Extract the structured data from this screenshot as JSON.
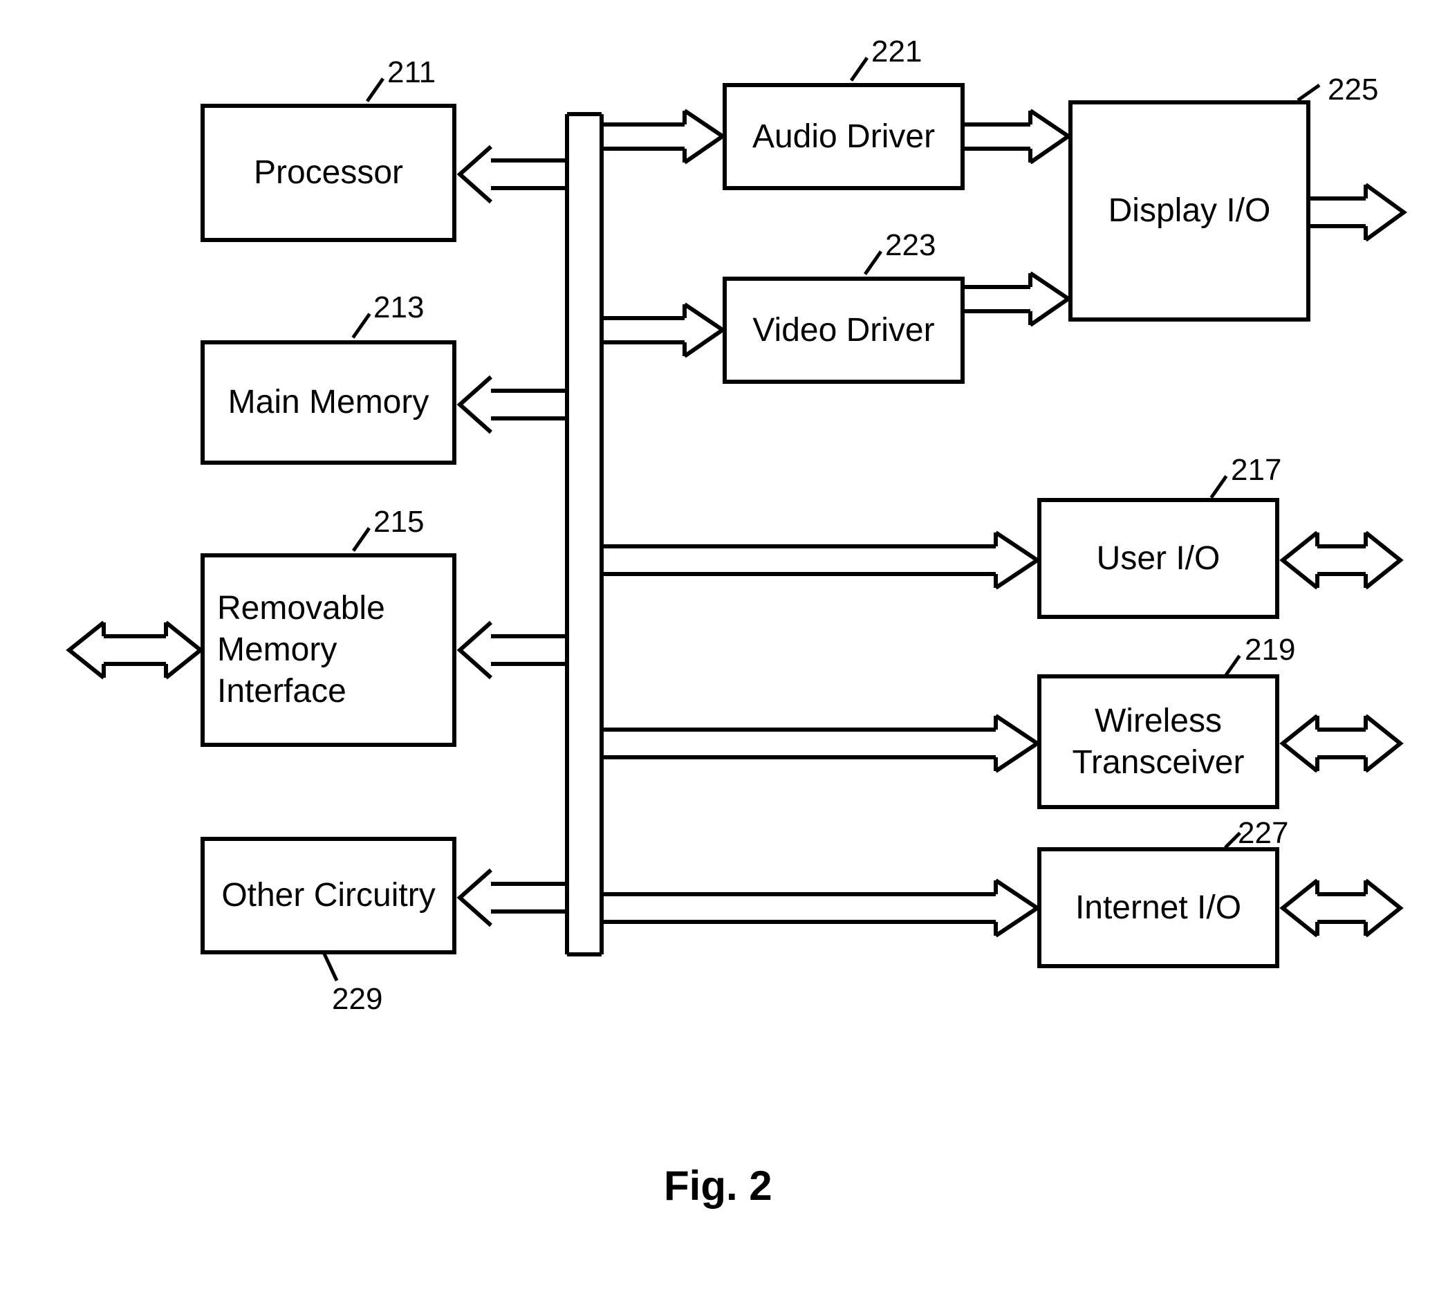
{
  "figure_label": "Fig. 2",
  "blocks": {
    "processor": {
      "label": "Processor",
      "num": "211"
    },
    "main_memory": {
      "label": "Main Memory",
      "num": "213"
    },
    "rmi": {
      "label": "Removable\nMemory\nInterface",
      "num": "215"
    },
    "other": {
      "label": "Other Circuitry",
      "num": "229"
    },
    "audio": {
      "label": "Audio Driver",
      "num": "221"
    },
    "video": {
      "label": "Video Driver",
      "num": "223"
    },
    "display": {
      "label": "Display I/O",
      "num": "225"
    },
    "userio": {
      "label": "User I/O",
      "num": "217"
    },
    "wireless": {
      "label": "Wireless\nTransceiver",
      "num": "219"
    },
    "internet": {
      "label": "Internet I/O",
      "num": "227"
    }
  }
}
